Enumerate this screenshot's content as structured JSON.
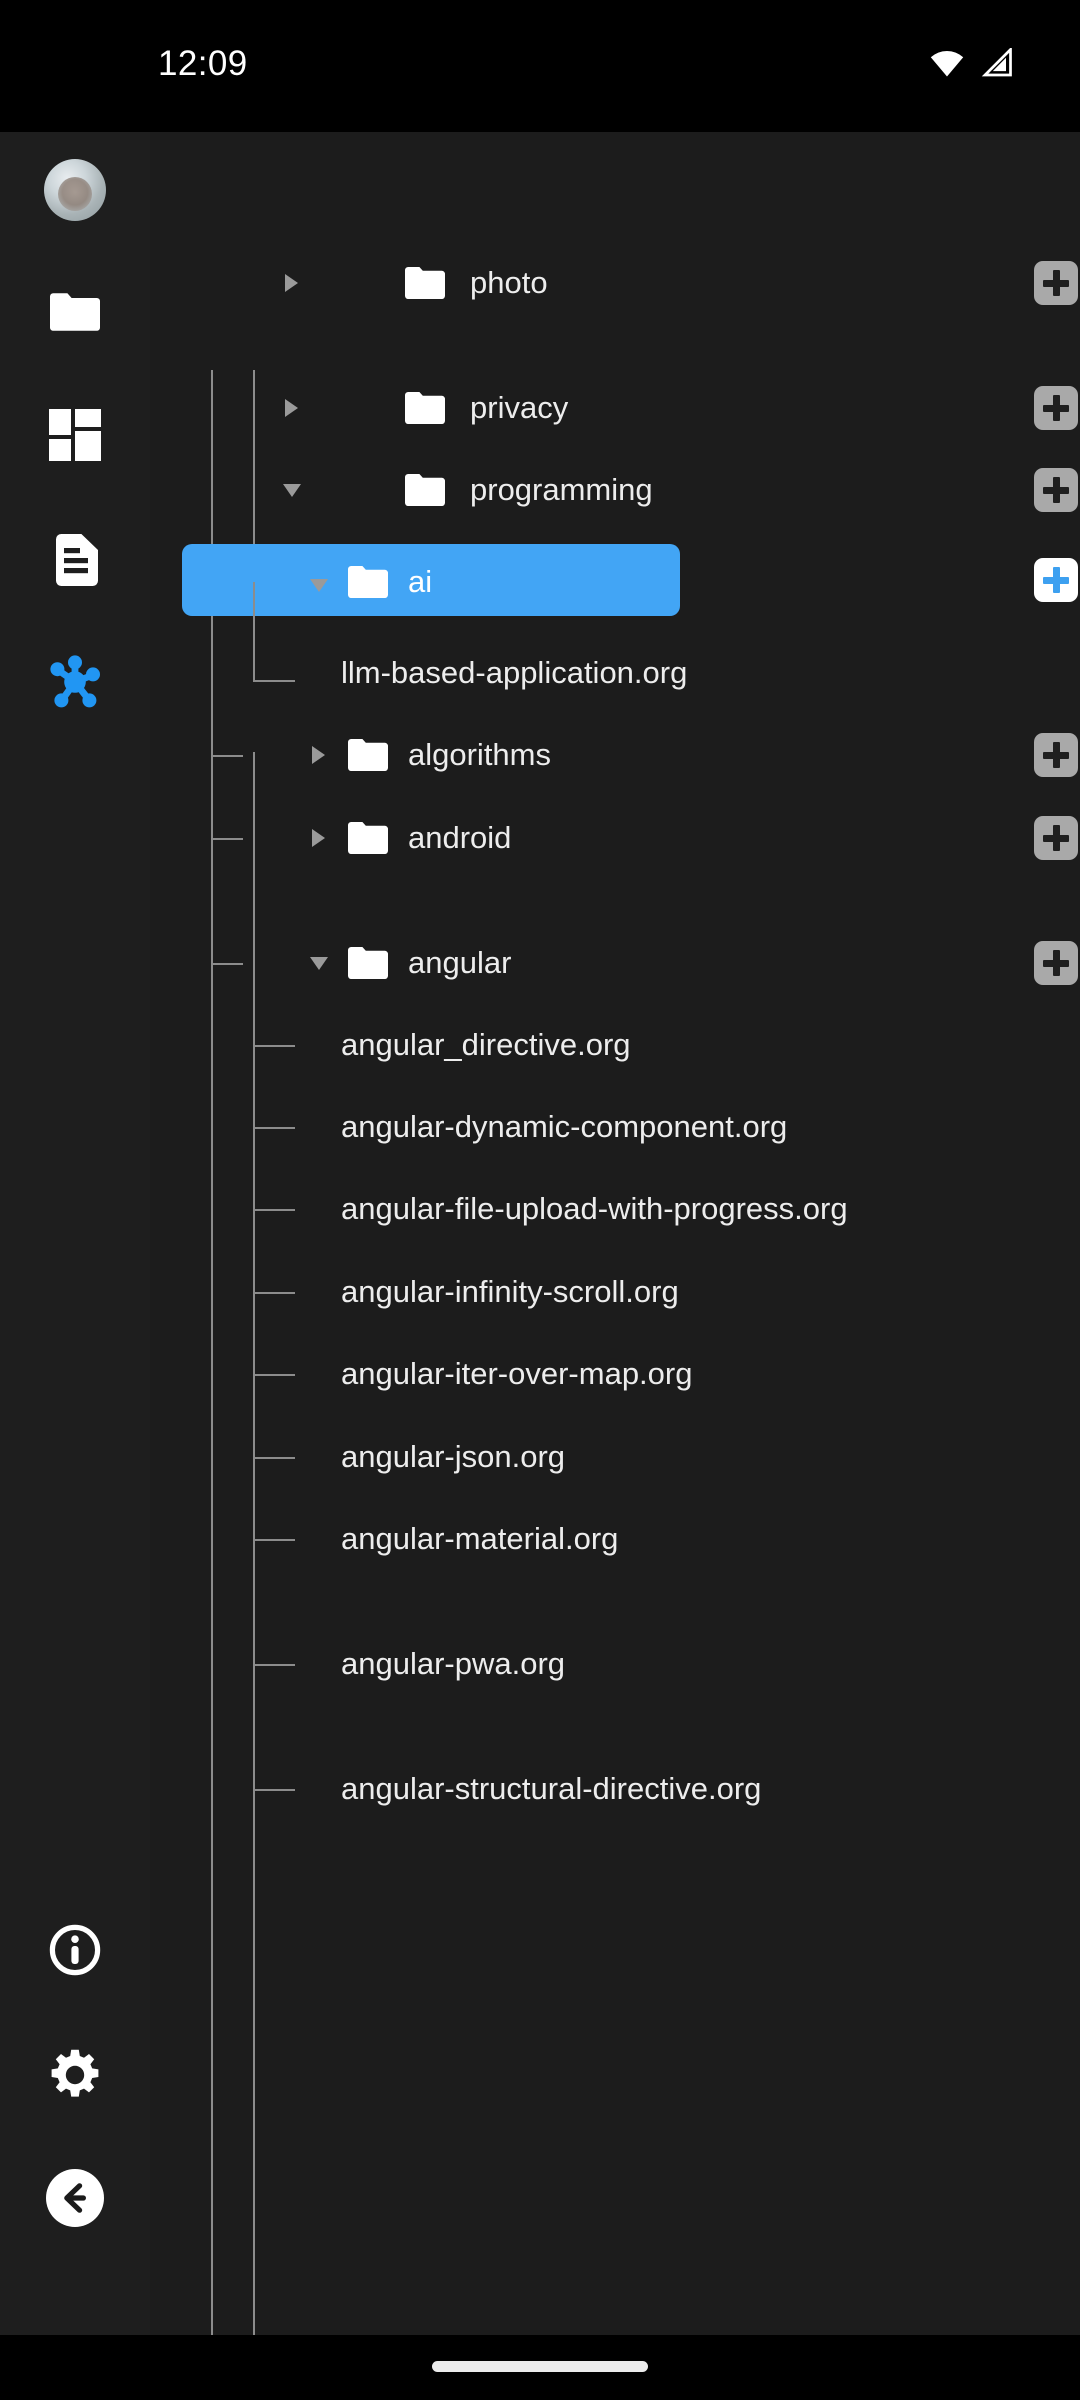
{
  "status_bar": {
    "time": "12:09",
    "icons": [
      "wifi-icon",
      "cellular-signal-icon"
    ]
  },
  "sidebar": {
    "items": [
      {
        "name": "avatar",
        "icon": "user-avatar",
        "label": ""
      },
      {
        "name": "files",
        "icon": "folder-icon",
        "label": ""
      },
      {
        "name": "dashboard",
        "icon": "grid-dashboard-icon",
        "label": ""
      },
      {
        "name": "documents",
        "icon": "document-icon",
        "label": ""
      },
      {
        "name": "graph",
        "icon": "graph-network-icon",
        "label": ""
      }
    ],
    "bottom_items": [
      {
        "name": "info",
        "icon": "info-circle-icon",
        "label": ""
      },
      {
        "name": "settings",
        "icon": "gear-icon",
        "label": ""
      },
      {
        "name": "back",
        "icon": "back-arrow-icon",
        "label": ""
      }
    ]
  },
  "colors": {
    "accent": "#42a5f5",
    "background": "#1c1c1c",
    "sidebar_background": "#1e1e1e",
    "status_background": "#000000",
    "text": "#ededed",
    "tree_line": "#8c8c8c",
    "plus_button": "#a9a9a9",
    "kebab_dot": "#a3a3a3"
  },
  "tree": {
    "rows": [
      {
        "id": "photo",
        "label": "photo",
        "type": "folder",
        "depth": 0,
        "expanded": false,
        "selected": false
      },
      {
        "id": "privacy",
        "label": "privacy",
        "type": "folder",
        "depth": 0,
        "expanded": false,
        "selected": false
      },
      {
        "id": "programming",
        "label": "programming",
        "type": "folder",
        "depth": 0,
        "expanded": true,
        "selected": false
      },
      {
        "id": "ai",
        "label": "ai",
        "type": "folder",
        "depth": 1,
        "expanded": true,
        "selected": true
      },
      {
        "id": "llm",
        "label": "llm-based-application.org",
        "type": "file",
        "depth": 2,
        "expanded": false,
        "selected": false
      },
      {
        "id": "algorithms",
        "label": "algorithms",
        "type": "folder",
        "depth": 1,
        "expanded": false,
        "selected": false
      },
      {
        "id": "android",
        "label": "android",
        "type": "folder",
        "depth": 1,
        "expanded": false,
        "selected": false
      },
      {
        "id": "angular",
        "label": "angular",
        "type": "folder",
        "depth": 1,
        "expanded": true,
        "selected": false
      },
      {
        "id": "a-directive",
        "label": "angular_directive.org",
        "type": "file",
        "depth": 2,
        "expanded": false,
        "selected": false
      },
      {
        "id": "a-dynamic",
        "label": "angular-dynamic-component.org",
        "type": "file",
        "depth": 2,
        "expanded": false,
        "selected": false
      },
      {
        "id": "a-upload",
        "label": "angular-file-upload-with-progress.org",
        "type": "file",
        "depth": 2,
        "expanded": false,
        "selected": false
      },
      {
        "id": "a-infinity",
        "label": "angular-infinity-scroll.org",
        "type": "file",
        "depth": 2,
        "expanded": false,
        "selected": false
      },
      {
        "id": "a-iter",
        "label": "angular-iter-over-map.org",
        "type": "file",
        "depth": 2,
        "expanded": false,
        "selected": false
      },
      {
        "id": "a-json",
        "label": "angular-json.org",
        "type": "file",
        "depth": 2,
        "expanded": false,
        "selected": false
      },
      {
        "id": "a-material",
        "label": "angular-material.org",
        "type": "file",
        "depth": 2,
        "expanded": false,
        "selected": false
      },
      {
        "id": "a-pwa",
        "label": "angular-pwa.org",
        "type": "file",
        "depth": 2,
        "expanded": false,
        "selected": false
      },
      {
        "id": "a-structural",
        "label": "angular-structural-directive.org",
        "type": "file",
        "depth": 2,
        "expanded": false,
        "selected": false
      }
    ],
    "add_button_label": "+",
    "menu_button_label": "⋮"
  }
}
